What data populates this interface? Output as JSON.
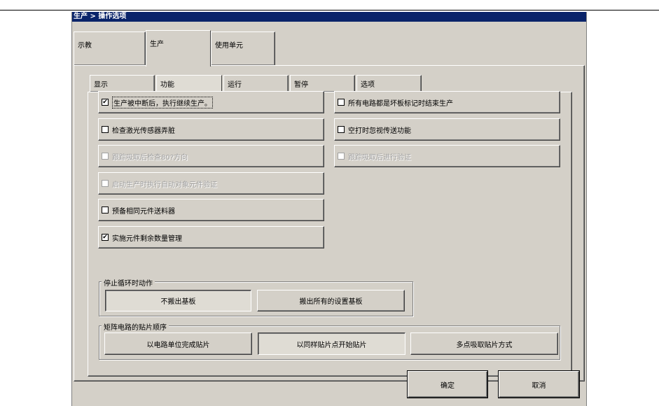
{
  "window": {
    "title": "生产 > 操作选项"
  },
  "outer_tabs": [
    {
      "label": "示教"
    },
    {
      "label": "生产"
    },
    {
      "label": "使用单元"
    }
  ],
  "inner_tabs": [
    {
      "label": "显示"
    },
    {
      "label": "功能"
    },
    {
      "label": "运行"
    },
    {
      "label": "暂停"
    },
    {
      "label": "选项"
    }
  ],
  "options_left": [
    {
      "label": "生产被中断后，执行继续生产。",
      "checked": true,
      "enabled": true
    },
    {
      "label": "检查激光传感器弄脏",
      "checked": false,
      "enabled": true
    },
    {
      "label": "跟踪吸取后检查80?方向",
      "checked": false,
      "enabled": false
    },
    {
      "label": "启动生产时执行自动对象元件验证",
      "checked": false,
      "enabled": false
    },
    {
      "label": "预备相同元件送料器",
      "checked": false,
      "enabled": true
    },
    {
      "label": "实施元件剩余数量管理",
      "checked": true,
      "enabled": true
    }
  ],
  "options_right": [
    {
      "label": "所有电路都是坏板标记时结束生产",
      "checked": false,
      "enabled": true
    },
    {
      "label": "空打时忽视传送功能",
      "checked": false,
      "enabled": true
    },
    {
      "label": "跟踪吸取后进行验证",
      "checked": false,
      "enabled": false
    }
  ],
  "stop_group": {
    "title": "停止循环时动作",
    "buttons": [
      {
        "label": "不搬出基板",
        "selected": true
      },
      {
        "label": "搬出所有的设置基板",
        "selected": false
      }
    ]
  },
  "matrix_group": {
    "title": "矩阵电路的贴片顺序",
    "buttons": [
      {
        "label": "以电路单位完成贴片",
        "selected": false
      },
      {
        "label": "以同样贴片点开始贴片",
        "selected": true
      },
      {
        "label": "多点吸取贴片方式",
        "selected": false
      }
    ]
  },
  "footer": {
    "ok": "确定",
    "cancel": "取消"
  },
  "check_mark": "✔"
}
